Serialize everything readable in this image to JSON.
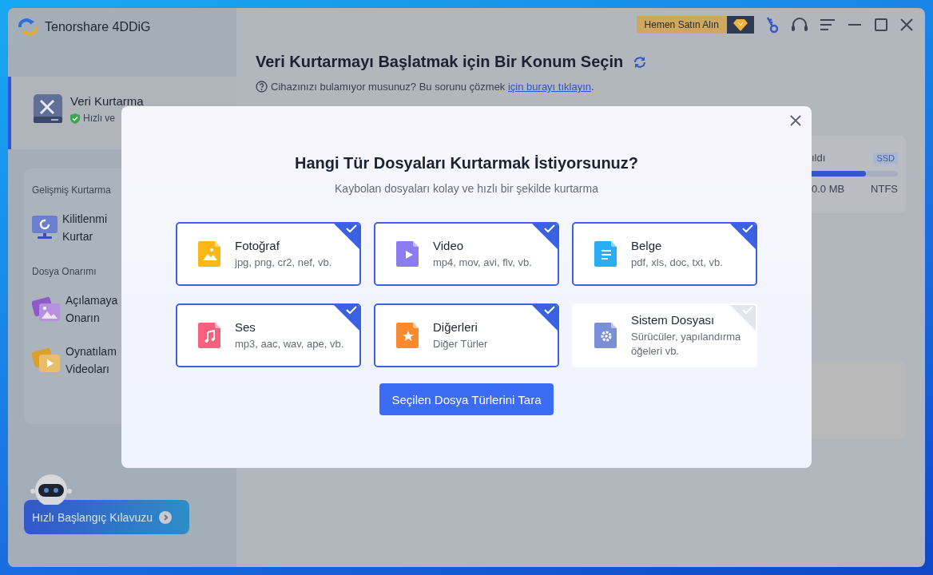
{
  "app": {
    "title": "Tenorshare 4DDiG"
  },
  "sidebar": {
    "active_item": {
      "title": "Veri Kurtarma",
      "subtitle": "Hızlı ve",
      "selected": true
    },
    "sections": [
      {
        "heading": "Gelişmiş Kurtarma",
        "items": [
          {
            "kind": "computer",
            "lines": [
              "Kilitlenmi",
              "Kurtar"
            ],
            "selected": false
          }
        ]
      },
      {
        "heading": "Dosya Onarımı",
        "items": [
          {
            "kind": "photo",
            "lines": [
              "Açılamaya",
              "Onarın"
            ],
            "selected": false
          },
          {
            "kind": "video",
            "lines": [
              "Oynatılam",
              "Videoları"
            ],
            "selected": false
          }
        ]
      }
    ],
    "guide_button": "Hızlı Başlangıç Kılavuzu"
  },
  "toolbar": {
    "buy_button": "Hemen Satın Alın"
  },
  "main": {
    "title": "Veri Kurtarmayı Başlatmak için Bir Konum Seçin",
    "help_text": "Cihazınızı bulamıyor musunuz? Bu sorunu çözmek ",
    "help_link": "için burayı tıklayın",
    "help_end": ".",
    "drive": {
      "label": "ıldı",
      "badge": "SSD",
      "level": 0.8,
      "size": "0.0 MB",
      "filesystem": "NTFS"
    }
  },
  "dialog": {
    "title": "Hangi Tür Dosyaları Kurtarmak İstiyorsunuz?",
    "subtitle": "Kaybolan dosyaları kolay ve hızlı bir şekilde kurtarma",
    "file_types": [
      {
        "kind": "photo",
        "name": "Fotoğraf",
        "extensions": "jpg, png, cr2, nef, vb.",
        "selected": true
      },
      {
        "kind": "video",
        "name": "Video",
        "extensions": "mp4, mov, avi, flv, vb.",
        "selected": true
      },
      {
        "kind": "document",
        "name": "Belge",
        "extensions": "pdf, xls, doc, txt, vb.",
        "selected": true
      },
      {
        "kind": "audio",
        "name": "Ses",
        "extensions": "mp3, aac, wav, ape, vb.",
        "selected": true
      },
      {
        "kind": "other",
        "name": "Diğerleri",
        "extensions": "Diğer Türler",
        "selected": true
      },
      {
        "kind": "system",
        "name": "Sistem Dosyası",
        "extensions": "Sürücüler, yapılandırma öğeleri vb.",
        "selected": false
      }
    ],
    "scan_button": "Seçilen Dosya Türlerini Tara"
  }
}
